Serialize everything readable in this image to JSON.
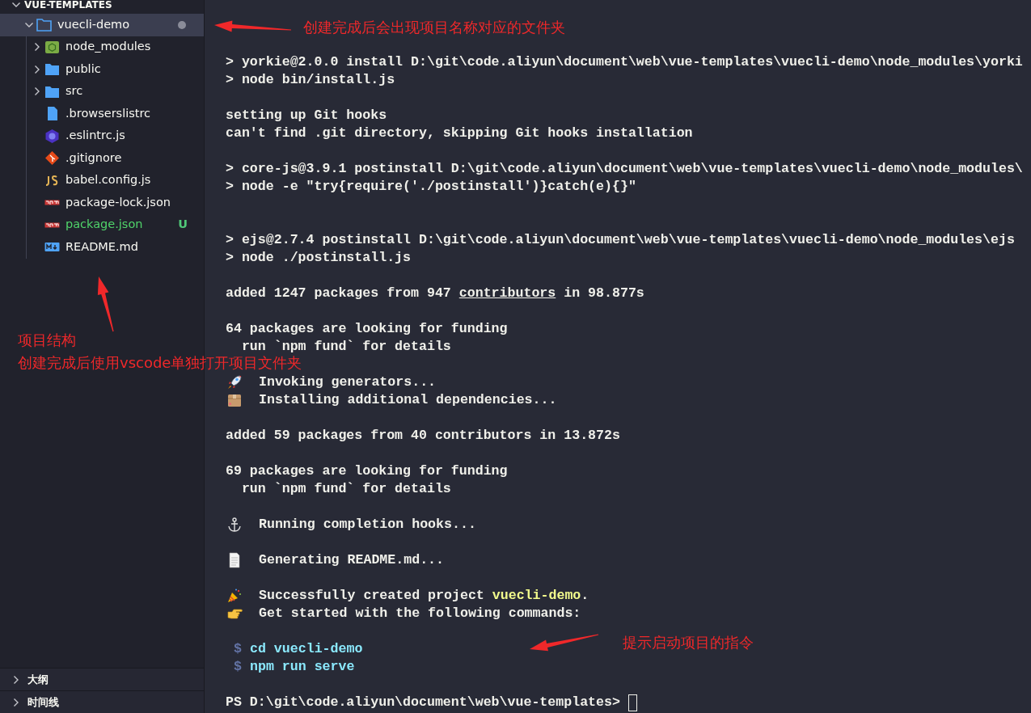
{
  "explorer": {
    "title": "VUE-TEMPLATES",
    "expanded": true,
    "items": [
      {
        "label": "vuecli-demo",
        "kind": "folder",
        "expanded": true,
        "selected": true,
        "modified": true,
        "children": [
          {
            "label": "node_modules",
            "kind": "modules",
            "expanded": false,
            "selected": false
          },
          {
            "label": "public",
            "kind": "folder",
            "expanded": false,
            "selected": false
          },
          {
            "label": "src",
            "kind": "folder",
            "expanded": false,
            "selected": false
          },
          {
            "label": ".browserslistrc",
            "kind": "text",
            "selected": false
          },
          {
            "label": ".eslintrc.js",
            "kind": "eslint",
            "selected": false
          },
          {
            "label": ".gitignore",
            "kind": "git",
            "selected": false
          },
          {
            "label": "babel.config.js",
            "kind": "script",
            "selected": false
          },
          {
            "label": "package-lock.json",
            "kind": "npm",
            "selected": false
          },
          {
            "label": "package.json",
            "kind": "npm",
            "selected": false,
            "status": "U"
          },
          {
            "label": "README.md",
            "kind": "markdown",
            "selected": false
          }
        ]
      }
    ]
  },
  "panels": [
    {
      "label": "大纲",
      "expanded": false
    },
    {
      "label": "时间线",
      "expanded": false
    }
  ],
  "terminal": {
    "lines": [
      {
        "kind": "output",
        "text": "> yorkie@2.0.0 install D:\\git\\code.aliyun\\document\\web\\vue-templates\\vuecli-demo\\node_modules\\yorki"
      },
      {
        "kind": "output",
        "text": "> node bin/install.js"
      },
      {
        "kind": "blank"
      },
      {
        "kind": "output",
        "text": "setting up Git hooks"
      },
      {
        "kind": "output",
        "text": "can't find .git directory, skipping Git hooks installation"
      },
      {
        "kind": "blank"
      },
      {
        "kind": "output",
        "text": "> core-js@3.9.1 postinstall D:\\git\\code.aliyun\\document\\web\\vue-templates\\vuecli-demo\\node_modules\\"
      },
      {
        "kind": "output",
        "text": "> node -e \"try{require('./postinstall')}catch(e){}\""
      },
      {
        "kind": "blank"
      },
      {
        "kind": "blank"
      },
      {
        "kind": "output",
        "text": "> ejs@2.7.4 postinstall D:\\git\\code.aliyun\\document\\web\\vue-templates\\vuecli-demo\\node_modules\\ejs"
      },
      {
        "kind": "output",
        "text": "> node ./postinstall.js"
      },
      {
        "kind": "blank"
      },
      {
        "kind": "rich",
        "segments": [
          {
            "kind": "plain",
            "text": "added 1247 packages from 947 "
          },
          {
            "kind": "link",
            "text": "contributors"
          },
          {
            "kind": "plain",
            "text": " in 98.877s"
          }
        ]
      },
      {
        "kind": "blank"
      },
      {
        "kind": "output",
        "text": "64 packages are looking for funding"
      },
      {
        "kind": "output",
        "text": "  run `npm fund` for details"
      },
      {
        "kind": "blank"
      },
      {
        "kind": "step",
        "text": "Invoking generators..."
      },
      {
        "kind": "step",
        "text": "Installing additional dependencies..."
      },
      {
        "kind": "blank"
      },
      {
        "kind": "output",
        "text": "added 59 packages from 40 contributors in 13.872s"
      },
      {
        "kind": "blank"
      },
      {
        "kind": "output",
        "text": "69 packages are looking for funding"
      },
      {
        "kind": "output",
        "text": "  run `npm fund` for details"
      },
      {
        "kind": "blank"
      },
      {
        "kind": "step",
        "text": "Running completion hooks..."
      },
      {
        "kind": "blank"
      },
      {
        "kind": "step",
        "text": "Generating README.md..."
      },
      {
        "kind": "blank"
      },
      {
        "kind": "step",
        "segments": [
          {
            "kind": "plain",
            "text": "Successfully created project "
          },
          {
            "kind": "highlight",
            "text": "vuecli-demo"
          },
          {
            "kind": "plain",
            "text": "."
          }
        ]
      },
      {
        "kind": "step",
        "text": "Get started with the following commands:"
      },
      {
        "kind": "blank"
      },
      {
        "kind": "command",
        "prompt": "$",
        "text": "cd vuecli-demo"
      },
      {
        "kind": "command",
        "prompt": "$",
        "text": "npm run serve"
      },
      {
        "kind": "blank"
      },
      {
        "kind": "prompt",
        "text": "PS D:\\git\\code.aliyun\\document\\web\\vue-templates>"
      }
    ]
  },
  "annotations": [
    {
      "lines": [
        "创建完成后会出现项目名称对应的文件夹"
      ]
    },
    {
      "lines": [
        "项目结构",
        "创建完成后使用vscode单独打开项目文件夹"
      ]
    },
    {
      "lines": [
        "提示启动项目的指令"
      ]
    }
  ]
}
